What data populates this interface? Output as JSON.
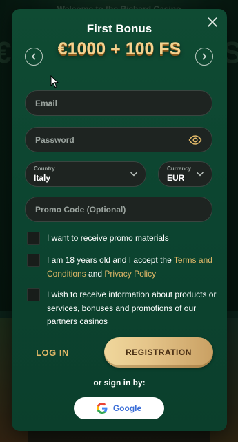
{
  "backdrop": {
    "heading": "Welcome to the Richard Casino",
    "big_left": "€",
    "big_right": "S"
  },
  "modal": {
    "title": "First Bonus",
    "amount": "€1000 + 100 FS",
    "email_placeholder": "Email",
    "password_placeholder": "Password",
    "country": {
      "label": "Country",
      "value": "Italy"
    },
    "currency": {
      "label": "Currency",
      "value": "EUR"
    },
    "promo_placeholder": "Promo Code (Optional)",
    "checks": {
      "promo": "I want to receive promo materials",
      "age_prefix": "I am 18 years old and I accept the ",
      "terms_link": "Terms and Conditions",
      "and": " and ",
      "privacy_link": "Privacy Policy",
      "partners": "I wish to receive information about products or services, bonuses and promotions of our partners casinos"
    },
    "login_label": "LOG IN",
    "register_label": "REGISTRATION",
    "or_text": "or sign in by:",
    "google_label": "Google"
  },
  "colors": {
    "accent_gold": "#e0b868",
    "modal_green": "#0f4b33",
    "google_blue": "#3c6fd8"
  },
  "icons": [
    "close-icon",
    "chevron-left-icon",
    "chevron-right-icon",
    "eye-icon",
    "chevron-down-icon",
    "google-icon",
    "mouse-cursor-icon"
  ]
}
